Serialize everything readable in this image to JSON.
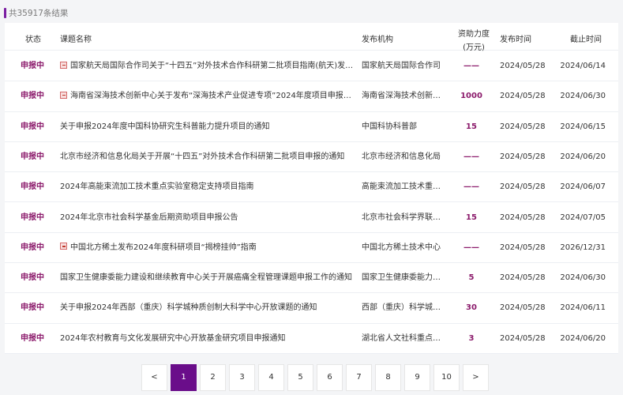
{
  "result_summary": "共35917条结果",
  "table": {
    "headers": {
      "status": "状态",
      "title": "课题名称",
      "org": "发布机构",
      "amount_line1": "资助力度",
      "amount_line2": "(万元)",
      "publish_date": "发布时间",
      "deadline": "截止时间"
    },
    "rows": [
      {
        "status": "申报中",
        "pdf": true,
        "title": "国家航天局国际合作司关于“十四五”对外技术合作科研第二批项目指南(航天)发布…",
        "org": "国家航天局国际合作司",
        "amount": "——",
        "publish": "2024/05/28",
        "deadline": "2024/06/14"
      },
      {
        "status": "申报中",
        "pdf": true,
        "title": "海南省深海技术创新中心关于发布“深海技术产业促进专项”2024年度项目申报指…",
        "org": "海南省深海技术创新…",
        "amount": "1000",
        "publish": "2024/05/28",
        "deadline": "2024/06/30"
      },
      {
        "status": "申报中",
        "pdf": false,
        "title": "关于申报2024年度中国科协研究生科普能力提升项目的通知",
        "org": "中国科协科普部",
        "amount": "15",
        "publish": "2024/05/28",
        "deadline": "2024/06/15"
      },
      {
        "status": "申报中",
        "pdf": false,
        "title": "北京市经济和信息化局关于开展“十四五”对外技术合作科研第二批项目申报的通知",
        "org": "北京市经济和信息化局",
        "amount": "——",
        "publish": "2024/05/28",
        "deadline": "2024/06/20"
      },
      {
        "status": "申报中",
        "pdf": false,
        "title": "2024年高能束流加工技术重点实验室稳定支持项目指南",
        "org": "高能束流加工技术重…",
        "amount": "——",
        "publish": "2024/05/28",
        "deadline": "2024/06/07"
      },
      {
        "status": "申报中",
        "pdf": false,
        "title": "2024年北京市社会科学基金后期资助项目申报公告",
        "org": "北京市社会科学界联…",
        "amount": "15",
        "publish": "2024/05/28",
        "deadline": "2024/07/05"
      },
      {
        "status": "申报中",
        "pdf": true,
        "title": "中国北方稀土发布2024年度科研项目“揭榜挂帅”指南",
        "org": "中国北方稀土技术中心",
        "amount": "——",
        "publish": "2024/05/28",
        "deadline": "2026/12/31"
      },
      {
        "status": "申报中",
        "pdf": false,
        "title": "国家卫生健康委能力建设和继续教育中心关于开展癌痛全程管理课题申报工作的通知",
        "org": "国家卫生健康委能力…",
        "amount": "5",
        "publish": "2024/05/28",
        "deadline": "2024/06/30"
      },
      {
        "status": "申报中",
        "pdf": false,
        "title": "关于申报2024年西部（重庆）科学城种质创制大科学中心开放课题的通知",
        "org": "西部（重庆）科学城…",
        "amount": "30",
        "publish": "2024/05/28",
        "deadline": "2024/06/11"
      },
      {
        "status": "申报中",
        "pdf": false,
        "title": "2024年农村教育与文化发展研究中心开放基金研究项目申报通知",
        "org": "湖北省人文社科重点…",
        "amount": "3",
        "publish": "2024/05/28",
        "deadline": "2024/06/20"
      }
    ]
  },
  "pagination": {
    "prev": "<",
    "next": ">",
    "pages": [
      "1",
      "2",
      "3",
      "4",
      "5",
      "6",
      "7",
      "8",
      "9",
      "10"
    ],
    "current": "1"
  },
  "colors": {
    "accent": "#6a0d8a",
    "status_text": "#8b1a6b",
    "pdf_icon": "#c0392b"
  }
}
